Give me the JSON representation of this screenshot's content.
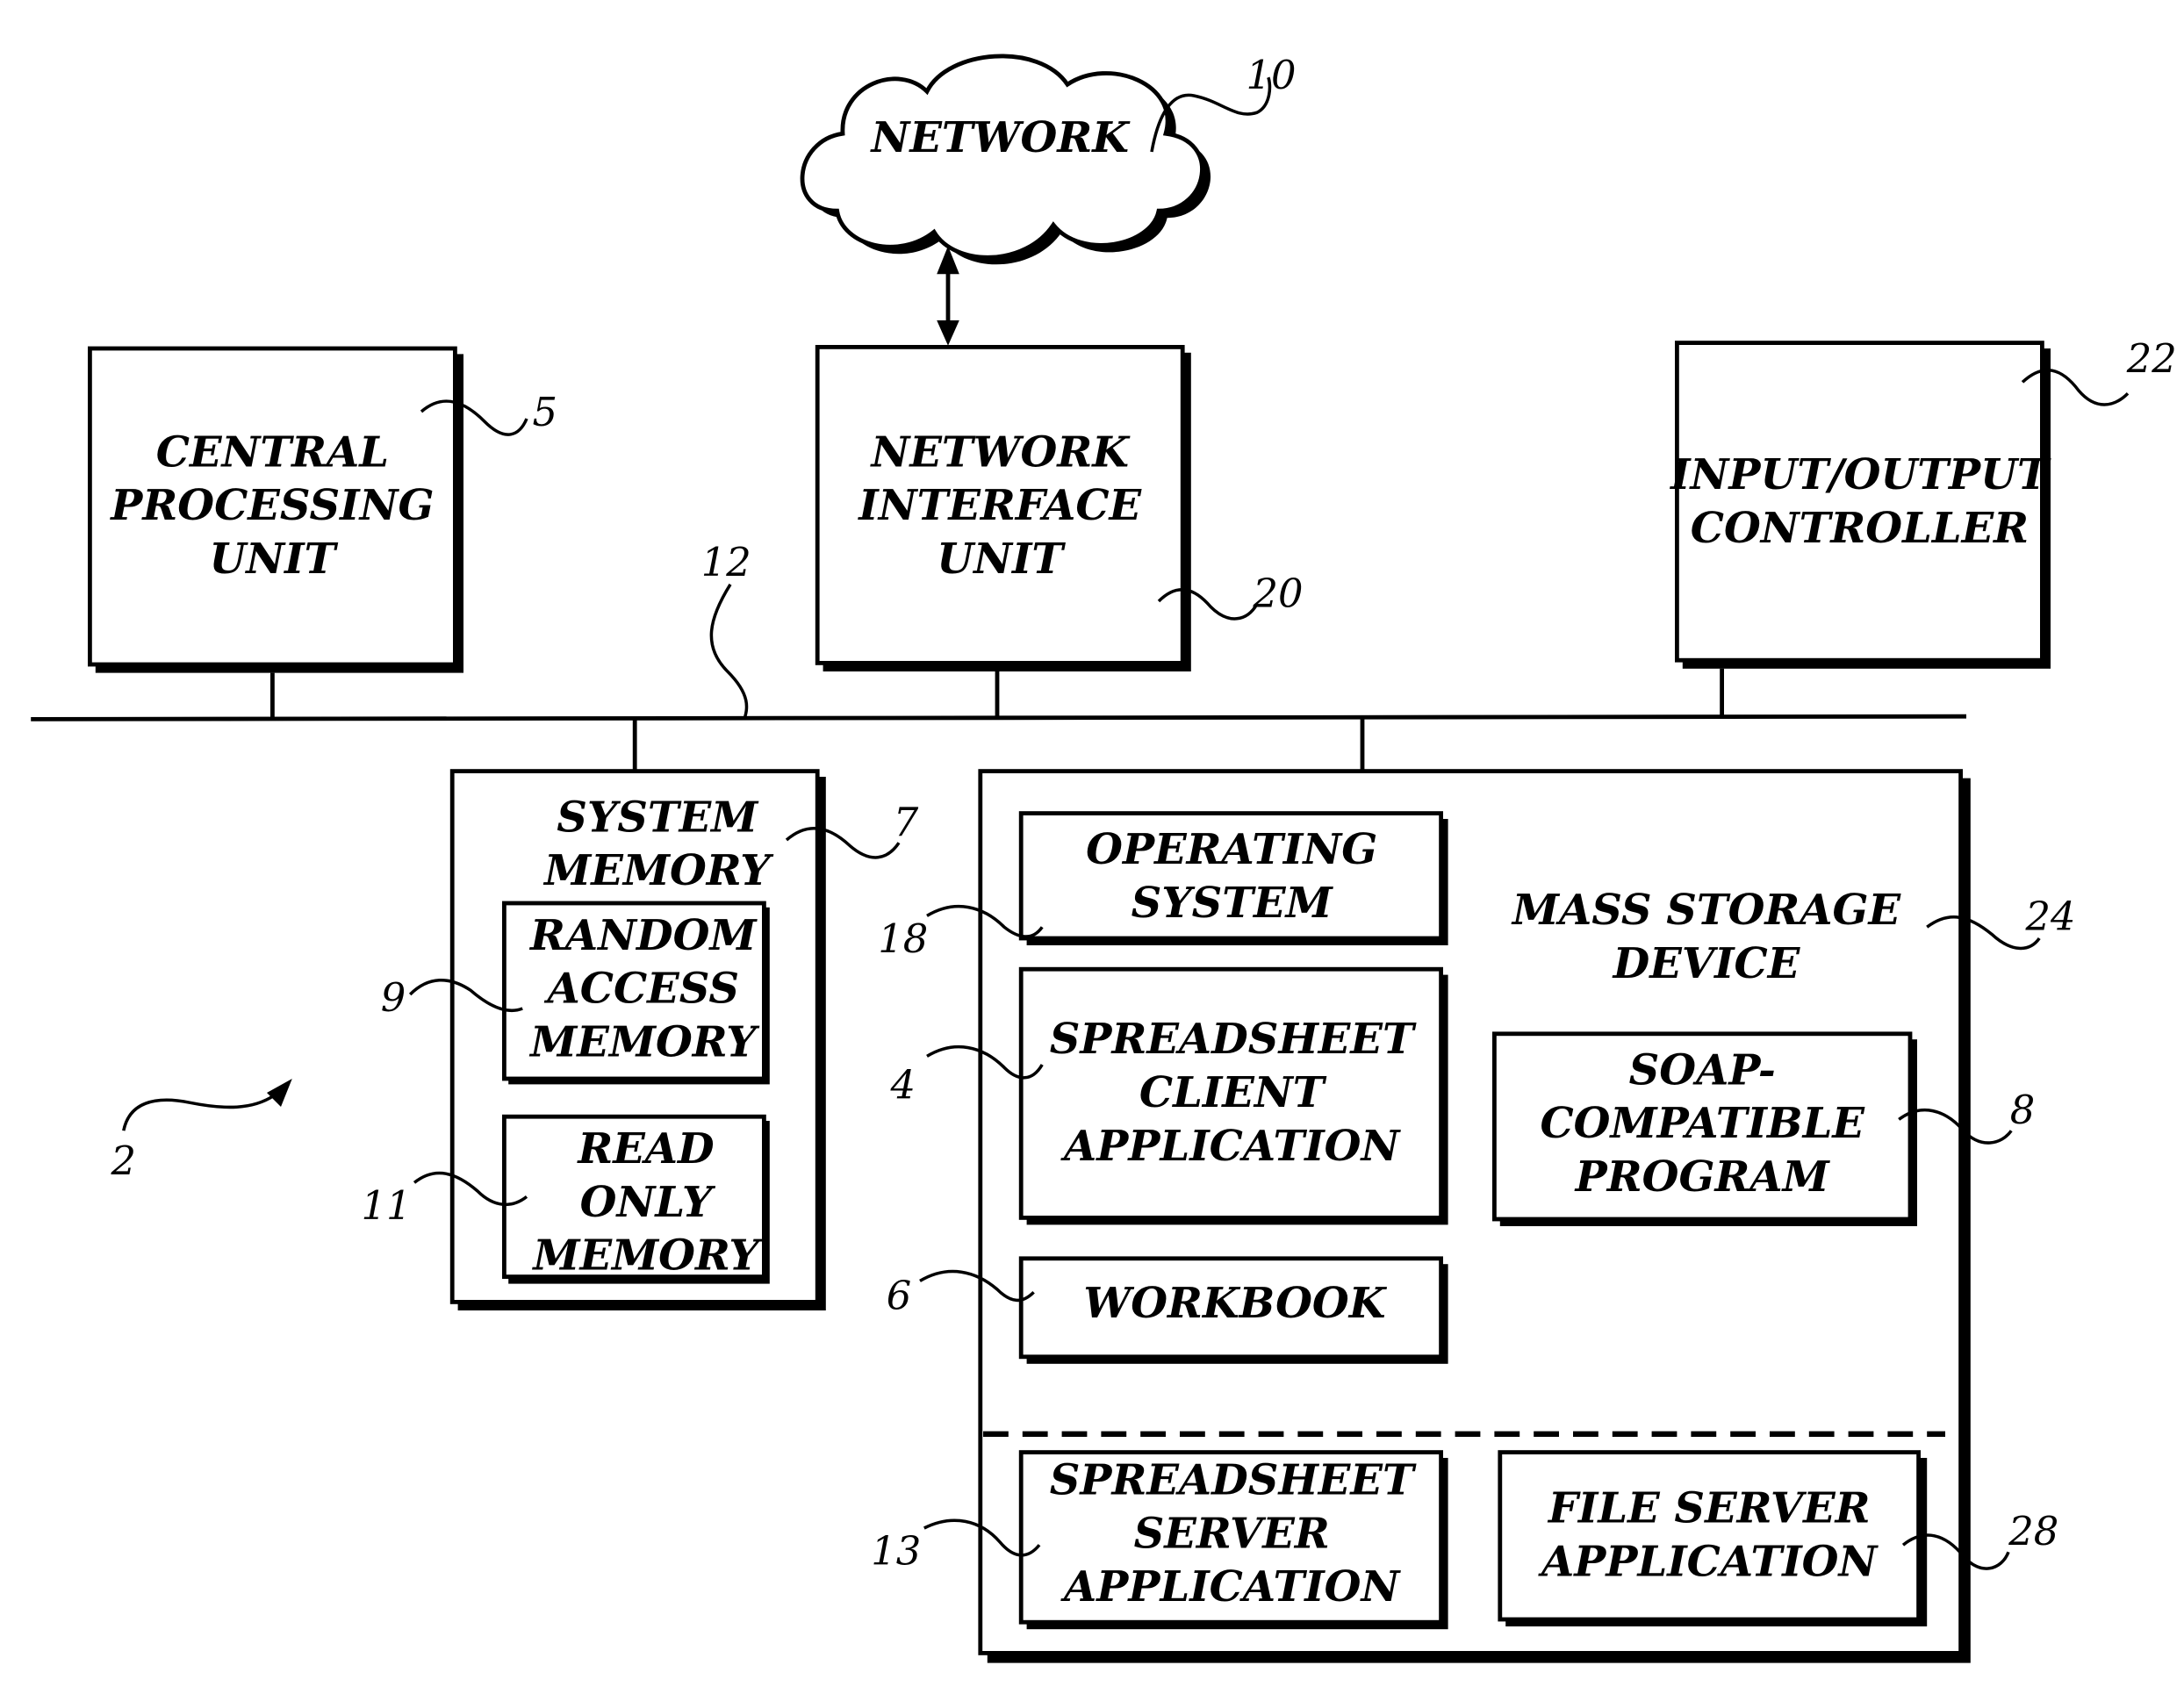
{
  "figure_ref": "2",
  "network": {
    "label": "NETWORK",
    "ref": "10"
  },
  "bus": {
    "ref": "12"
  },
  "cpu": {
    "lines": [
      "CENTRAL",
      "PROCESSING",
      "UNIT"
    ],
    "ref": "5"
  },
  "niu": {
    "lines": [
      "NETWORK",
      "INTERFACE",
      "UNIT"
    ],
    "ref": "20"
  },
  "io": {
    "lines": [
      "INPUT/OUTPUT",
      "CONTROLLER"
    ],
    "ref": "22"
  },
  "system_memory": {
    "lines": [
      "SYSTEM",
      "MEMORY"
    ],
    "ref": "7"
  },
  "ram": {
    "lines": [
      "RANDOM",
      "ACCESS",
      "MEMORY"
    ],
    "ref": "9"
  },
  "rom": {
    "lines": [
      "READ",
      "ONLY",
      "MEMORY"
    ],
    "ref": "11"
  },
  "mass_storage": {
    "lines": [
      "MASS STORAGE",
      "DEVICE"
    ],
    "ref": "24"
  },
  "os": {
    "lines": [
      "OPERATING",
      "SYSTEM"
    ],
    "ref": "18"
  },
  "client_app": {
    "lines": [
      "SPREADSHEET",
      "CLIENT",
      "APPLICATION"
    ],
    "ref": "4"
  },
  "workbook": {
    "lines": [
      "WORKBOOK"
    ],
    "ref": "6"
  },
  "soap": {
    "lines": [
      "SOAP-",
      "COMPATIBLE",
      "PROGRAM"
    ],
    "ref": "8"
  },
  "server_app": {
    "lines": [
      "SPREADSHEET",
      "SERVER",
      "APPLICATION"
    ],
    "ref": "13"
  },
  "file_server": {
    "lines": [
      "FILE SERVER",
      "APPLICATION"
    ],
    "ref": "28"
  }
}
